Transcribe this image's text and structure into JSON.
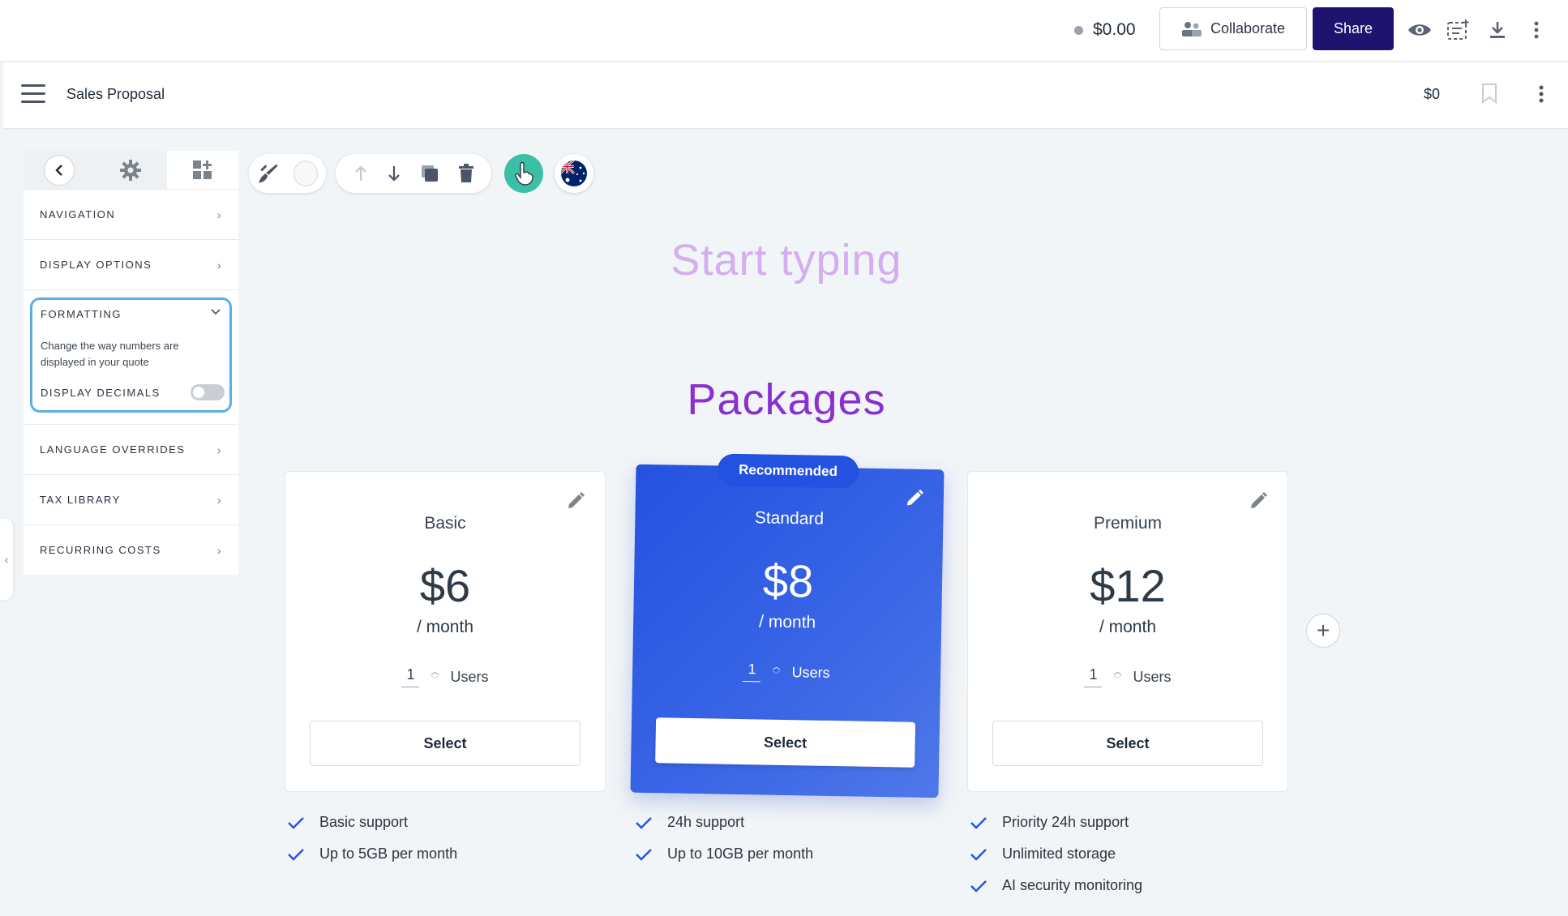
{
  "topbar": {
    "cost": "$0.00",
    "collaborate_label": "Collaborate",
    "share_label": "Share",
    "icons": [
      "preview-eye-icon",
      "variables-icon",
      "download-icon",
      "more-vertical-icon"
    ]
  },
  "docbar": {
    "title": "Sales Proposal",
    "total": "$0"
  },
  "panel": {
    "tab_icons": [
      "back-chevron-icon",
      "gear-icon",
      "add-widget-icon"
    ],
    "items": [
      {
        "label": "NAVIGATION"
      },
      {
        "label": "DISPLAY OPTIONS"
      },
      {
        "label": "LANGUAGE OVERRIDES"
      },
      {
        "label": "TAX LIBRARY"
      },
      {
        "label": "RECURRING COSTS"
      }
    ],
    "formatting": {
      "label": "FORMATTING",
      "description": "Change the way numbers are displayed in your quote",
      "toggle_label": "DISPLAY DECIMALS",
      "toggle_on": false
    }
  },
  "content": {
    "heading_placeholder": "Start typing",
    "section_title": "Packages",
    "recommended_badge": "Recommended",
    "cards": [
      {
        "name": "Basic",
        "price": "$6",
        "period": "/ month",
        "qty": "1",
        "unit": "Users",
        "select_label": "Select",
        "features": [
          "Basic support",
          "Up to 5GB per month"
        ]
      },
      {
        "name": "Standard",
        "price": "$8",
        "period": "/ month",
        "qty": "1",
        "unit": "Users",
        "select_label": "Select",
        "features": [
          "24h support",
          "Up to 10GB per month"
        ]
      },
      {
        "name": "Premium",
        "price": "$12",
        "period": "/ month",
        "qty": "1",
        "unit": "Users",
        "select_label": "Select",
        "features": [
          "Priority 24h support",
          "Unlimited storage",
          "AI security monitoring"
        ]
      }
    ]
  },
  "colors": {
    "share": "#1e1470",
    "accent_blue": "#2452e0",
    "heading_purple": "#8a2fd1",
    "placeholder_purple": "#d3aef0",
    "pointer_teal": "#3cbfa7",
    "focus_outline": "#5aaee6"
  }
}
